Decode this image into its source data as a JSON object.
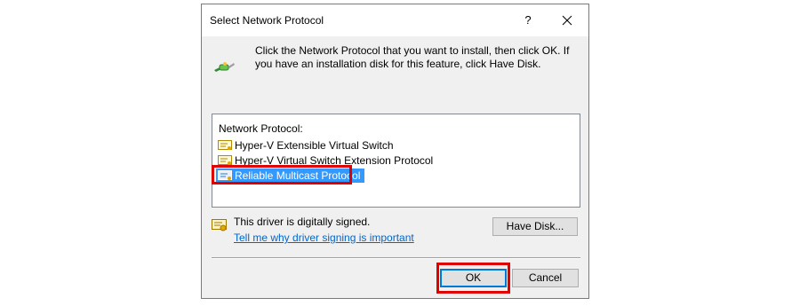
{
  "window": {
    "title": "Select Network Protocol",
    "help_label": "?",
    "close_icon": "close-icon"
  },
  "instructions": {
    "icon": "network-protocol-icon",
    "text": "Click the Network Protocol that you want to install, then click OK. If you have an installation disk for this feature, click Have Disk."
  },
  "protocol_list": {
    "header": "Network Protocol:",
    "items": [
      {
        "label": "Hyper-V Extensible Virtual Switch",
        "icon": "driver-cert-icon",
        "selected": false
      },
      {
        "label": "Hyper-V Virtual Switch Extension Protocol",
        "icon": "driver-cert-icon",
        "selected": false
      },
      {
        "label": "Reliable Multicast Protocol",
        "icon": "driver-cert-icon",
        "selected": true
      }
    ]
  },
  "driver_signing": {
    "icon": "signed-driver-icon",
    "status": "This driver is digitally signed.",
    "link": "Tell me why driver signing is important"
  },
  "buttons": {
    "have_disk": "Have Disk...",
    "ok": "OK",
    "cancel": "Cancel"
  },
  "colors": {
    "selection": "#3399ff",
    "highlight": "#e00000",
    "link": "#0066cc",
    "dialog_bg": "#f0f0f0"
  }
}
